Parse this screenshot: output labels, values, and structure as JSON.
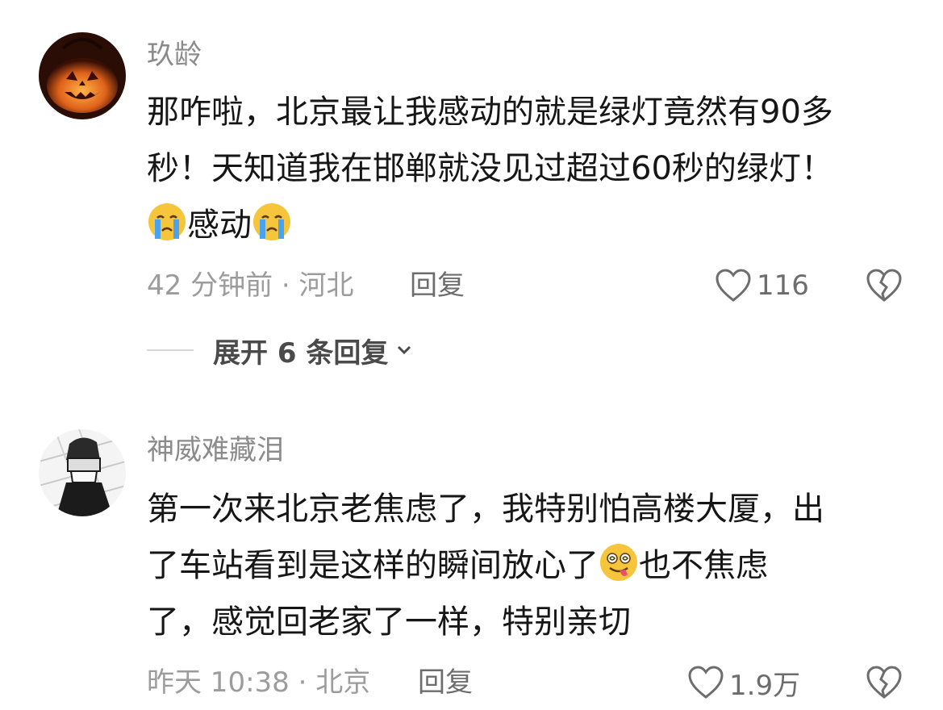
{
  "comments": [
    {
      "username": "玖龄",
      "text_line1": "那咋啦，北京最让我感动的就是绿灯竟然有90多",
      "text_line2": "秒！天知道我在邯郸就没见过超过60秒的绿灯！",
      "text_line3_mid": "感动",
      "line3_emoji": "crying-face",
      "time_location": "42 分钟前 · 河北",
      "reply_label": "回复",
      "like_count": "116",
      "expand_label": "展开 6 条回复"
    },
    {
      "username": "神威难藏泪",
      "text_line1": "第一次来北京老焦虑了，我特别怕高楼大厦，出",
      "text_line2_a": "了车站看到是这样的瞬间放心了",
      "text_line2_emoji": "dizzy-tongue-face",
      "text_line2_b": "也不焦虑",
      "text_line3": "了，感觉回老家了一样，特别亲切",
      "time_location": "昨天 10:38 · 北京",
      "reply_label": "回复",
      "like_count": "1.9万"
    }
  ],
  "icons": {
    "like": "heart-outline-icon",
    "dislike": "broken-heart-icon",
    "expand": "chevron-down-icon"
  },
  "colors": {
    "username": "#8b8b8b",
    "body_text": "#161616",
    "meta_text": "#9c9c9c",
    "icon_gray": "#6d6d6d",
    "emoji_yellow": "#f6c53b",
    "tear_blue": "#4aa3f0"
  }
}
